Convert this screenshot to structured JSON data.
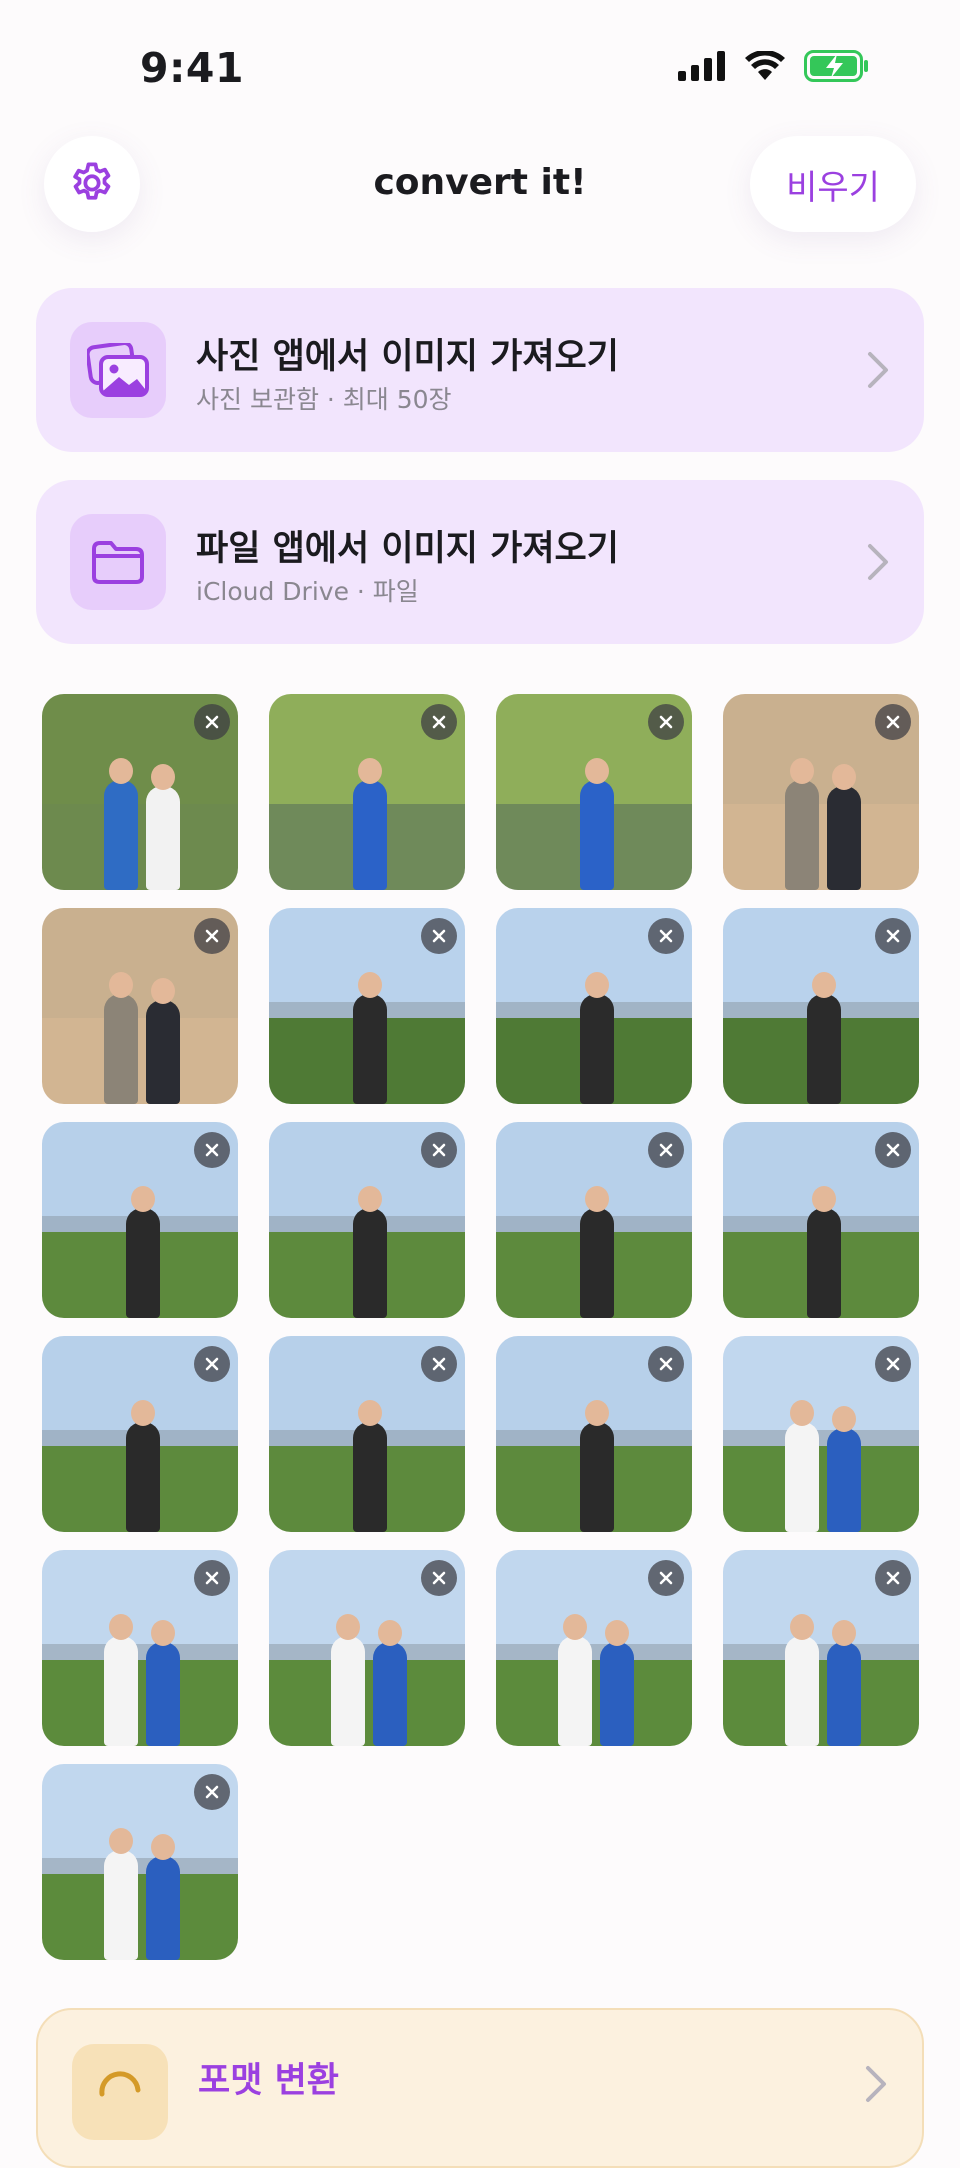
{
  "status": {
    "time": "9:41"
  },
  "header": {
    "title": "convert it!",
    "clear_label": "비우기"
  },
  "imports": [
    {
      "title": "사진 앱에서 이미지 가져오기",
      "subtitle": "사진 보관함 · 최대 50장",
      "icon": "photos-icon"
    },
    {
      "title": "파일 앱에서 이미지 가져오기",
      "subtitle": "iCloud Drive · 파일",
      "icon": "folder-icon"
    }
  ],
  "format": {
    "title": "포맷 변환",
    "icon": "convert-icon"
  },
  "colors": {
    "accent": "#9b40e0",
    "card_bg": "#f2e5fd",
    "format_bg": "#fcf1df"
  },
  "photos": [
    {
      "scene": "sign"
    },
    {
      "scene": "pond"
    },
    {
      "scene": "pond"
    },
    {
      "scene": "monkey"
    },
    {
      "scene": "monkey"
    },
    {
      "scene": "viewback"
    },
    {
      "scene": "viewback"
    },
    {
      "scene": "viewback"
    },
    {
      "scene": "view1"
    },
    {
      "scene": "view1"
    },
    {
      "scene": "view1"
    },
    {
      "scene": "view1"
    },
    {
      "scene": "view1"
    },
    {
      "scene": "view1"
    },
    {
      "scene": "view1"
    },
    {
      "scene": "view2"
    },
    {
      "scene": "view2"
    },
    {
      "scene": "view2"
    },
    {
      "scene": "view2"
    },
    {
      "scene": "view2"
    },
    {
      "scene": "view2"
    }
  ]
}
